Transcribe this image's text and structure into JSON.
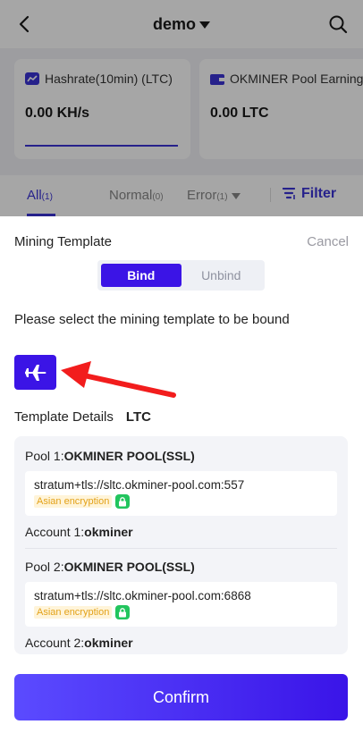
{
  "header": {
    "title": "demo"
  },
  "cards": [
    {
      "label": "Hashrate(10min) (LTC)",
      "value": "0.00 KH/s"
    },
    {
      "label": "OKMINER Pool Earnings",
      "value": "0.00 LTC"
    }
  ],
  "filters": {
    "all": "All",
    "all_count": "(1)",
    "normal": "Normal",
    "normal_count": "(0)",
    "error": "Error",
    "error_count": "(1)",
    "filter_label": "Filter"
  },
  "sheet": {
    "title": "Mining Template",
    "cancel": "Cancel",
    "bind": "Bind",
    "unbind": "Unbind",
    "prompt": "Please select the mining template to be bound",
    "details_label": "Template Details",
    "coin": "LTC",
    "pools": [
      {
        "label": "Pool 1:",
        "name": "OKMINER POOL(SSL)",
        "url": "stratum+tls://sltc.okminer-pool.com:557",
        "tag": "Asian encryption",
        "account_label": "Account 1:",
        "account": "okminer"
      },
      {
        "label": "Pool 2:",
        "name": "OKMINER POOL(SSL)",
        "url": "stratum+tls://sltc.okminer-pool.com:6868",
        "tag": "Asian encryption",
        "account_label": "Account 2:",
        "account": "okminer"
      }
    ],
    "confirm": "Confirm"
  },
  "colors": {
    "accent": "#3b14e6",
    "secure": "#22c55e",
    "tag": "#e3a21a"
  },
  "icons": [
    "back-arrow-icon",
    "search-icon",
    "dropdown-caret-icon",
    "hashrate-chart-icon",
    "wallet-icon",
    "filter-icon",
    "airplane-icon",
    "lock-icon"
  ]
}
